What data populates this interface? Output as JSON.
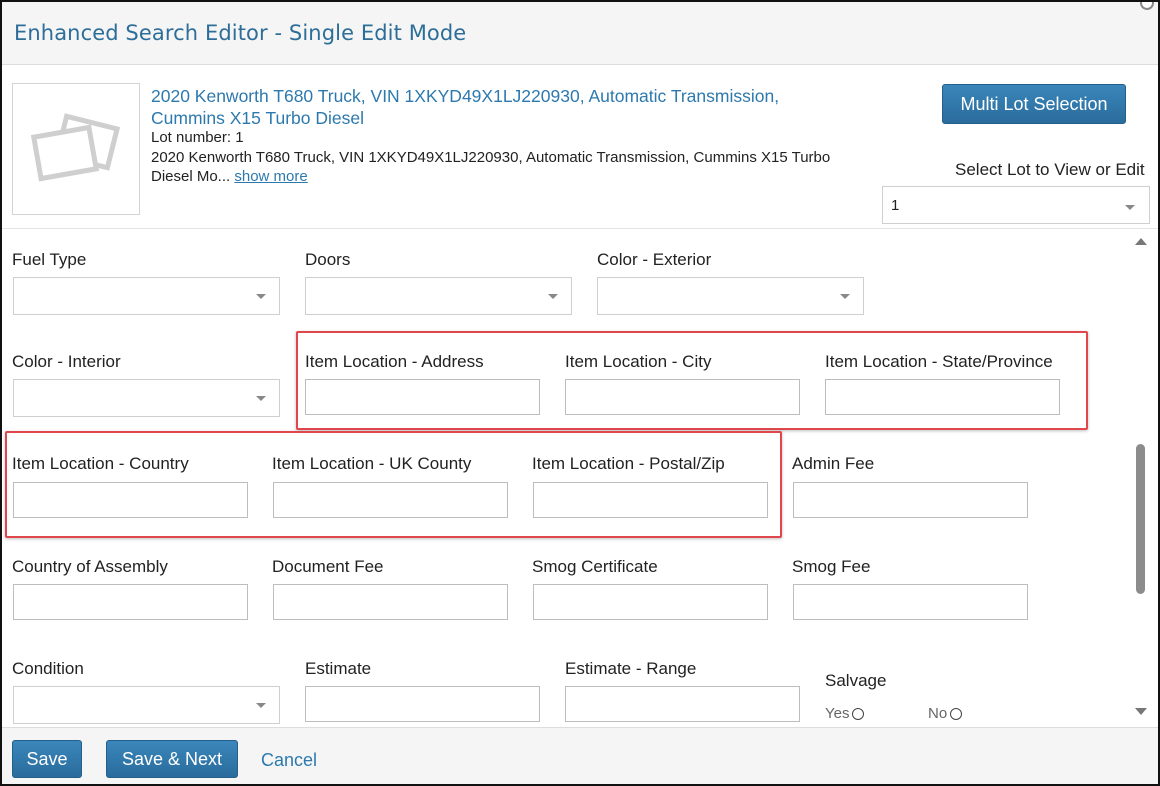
{
  "window": {
    "title": "Enhanced Search Editor - Single Edit Mode"
  },
  "lot": {
    "title": "2020 Kenworth T680 Truck, VIN 1XKYD49X1LJ220930, Automatic Transmission, Cummins X15 Turbo Diesel",
    "lot_number": "Lot number: 1",
    "description": "2020 Kenworth T680 Truck, VIN 1XKYD49X1LJ220930, Automatic Transmission, Cummins X15 Turbo Diesel Mo...",
    "show_more": "show more"
  },
  "header": {
    "multi_lot_button": "Multi Lot Selection",
    "select_lot_label": "Select Lot to View or Edit",
    "select_lot_value": "1"
  },
  "form": {
    "fuel_type": "Fuel Type",
    "doors": "Doors",
    "color_exterior": "Color - Exterior",
    "color_interior": "Color - Interior",
    "loc_address": "Item Location - Address",
    "loc_city": "Item Location - City",
    "loc_state": "Item Location - State/Province",
    "loc_country": "Item Location - Country",
    "loc_uk_county": "Item Location - UK County",
    "loc_postal": "Item Location - Postal/Zip",
    "admin_fee": "Admin Fee",
    "country_of_assembly": "Country of Assembly",
    "document_fee": "Document Fee",
    "smog_certificate": "Smog Certificate",
    "smog_fee": "Smog Fee",
    "condition": "Condition",
    "estimate": "Estimate",
    "estimate_range": "Estimate - Range",
    "salvage": "Salvage",
    "salvage_yes": "Yes",
    "salvage_no": "No"
  },
  "footer": {
    "save": "Save",
    "save_next": "Save & Next",
    "cancel": "Cancel"
  },
  "colors": {
    "accent": "#2d79ad",
    "title": "#2d6e99",
    "highlight": "#e0474c"
  }
}
